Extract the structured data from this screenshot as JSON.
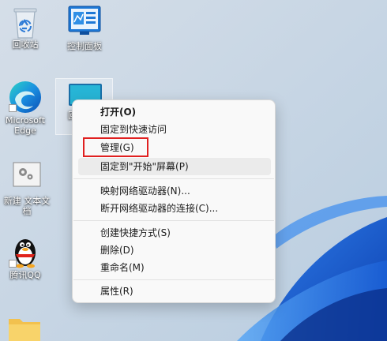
{
  "desktop": {
    "icons": [
      {
        "label": "回收站"
      },
      {
        "label": "控制面板"
      },
      {
        "label": "Microsoft Edge"
      },
      {
        "label": "新建 文本文档"
      },
      {
        "label": "腾讯QQ"
      },
      {
        "label": "回"
      }
    ]
  },
  "context_menu": {
    "items": [
      {
        "label": "打开(O)"
      },
      {
        "label": "固定到快速访问"
      },
      {
        "label": "管理(G)"
      },
      {
        "label": "固定到\"开始\"屏幕(P)"
      },
      {
        "label": "映射网络驱动器(N)..."
      },
      {
        "label": "断开网络驱动器的连接(C)..."
      },
      {
        "label": "创建快捷方式(S)"
      },
      {
        "label": "删除(D)"
      },
      {
        "label": "重命名(M)"
      },
      {
        "label": "属性(R)"
      }
    ],
    "highlighted_item": "管理(G)",
    "highlight_color": "#e02020"
  }
}
